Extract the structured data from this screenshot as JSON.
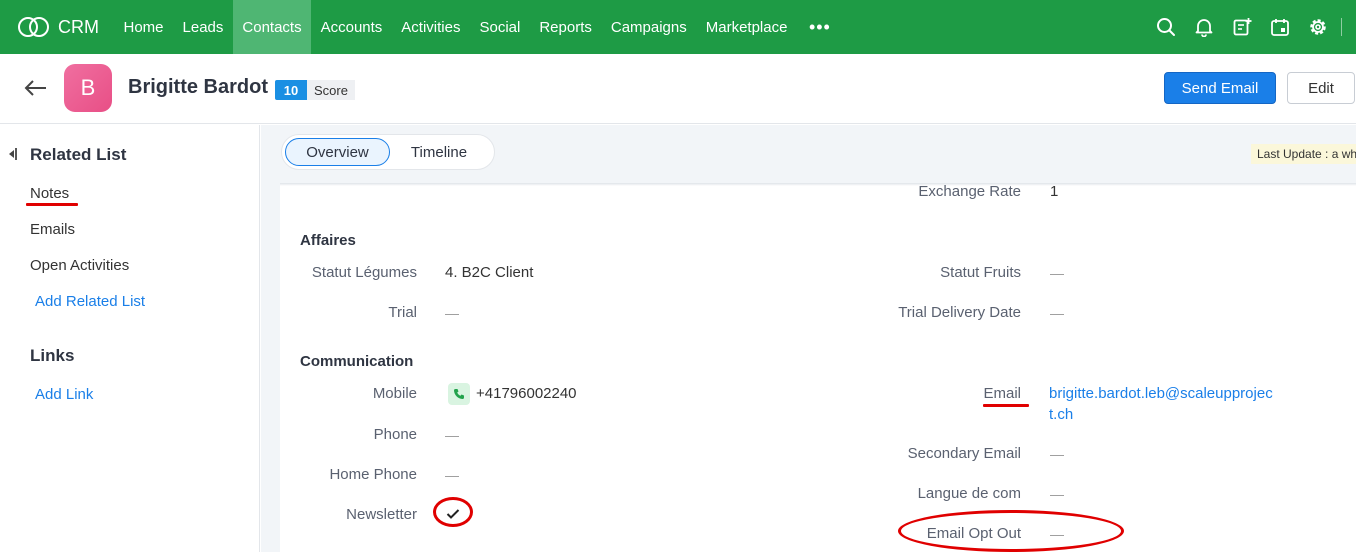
{
  "nav": {
    "logo_text": "CRM",
    "items": [
      "Home",
      "Leads",
      "Contacts",
      "Accounts",
      "Activities",
      "Social",
      "Reports",
      "Campaigns",
      "Marketplace"
    ],
    "active": "Contacts",
    "more": "•••",
    "accent": "#1e9b45"
  },
  "record": {
    "avatar_letter": "B",
    "name": "Brigitte Bardot",
    "score_value": "10",
    "score_label": "Score",
    "send_email_label": "Send Email",
    "edit_label": "Edit"
  },
  "sidebar": {
    "related_title": "Related List",
    "items": [
      "Notes",
      "Emails",
      "Open Activities"
    ],
    "add_related": "Add Related List",
    "links_title": "Links",
    "add_link": "Add Link"
  },
  "tabs": {
    "overview": "Overview",
    "timeline": "Timeline",
    "last_update": "Last Update : a wh"
  },
  "details": {
    "exchange_rate_label": "Exchange Rate",
    "exchange_rate_value": "1",
    "affaires": {
      "title": "Affaires",
      "statut_legumes_label": "Statut Légumes",
      "statut_legumes_value": "4. B2C Client",
      "statut_fruits_label": "Statut Fruits",
      "trial_label": "Trial",
      "trial_delivery_label": "Trial Delivery Date"
    },
    "communication": {
      "title": "Communication",
      "mobile_label": "Mobile",
      "mobile_value": "+41796002240",
      "email_label": "Email",
      "email_value": "brigitte.bardot.leb@scaleupproject.ch",
      "phone_label": "Phone",
      "secondary_email_label": "Secondary Email",
      "home_phone_label": "Home Phone",
      "langue_label": "Langue de com",
      "newsletter_label": "Newsletter",
      "newsletter_checked": true,
      "email_opt_out_label": "Email Opt Out"
    },
    "empty": "—"
  },
  "colors": {
    "annotation": "#e00000",
    "link": "#1a7fe8",
    "primary_button": "#1a7fe8"
  }
}
